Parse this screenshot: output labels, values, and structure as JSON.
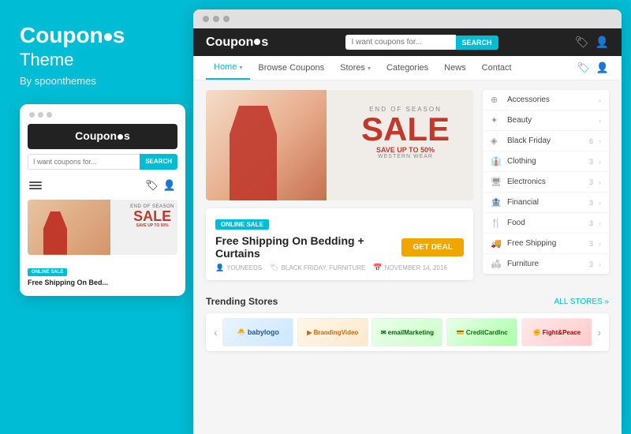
{
  "brand": {
    "name_part1": "Coupon",
    "name_dot": "●",
    "name_part2": "s",
    "subtitle": "Theme",
    "by": "By spoonthemes"
  },
  "mobile": {
    "logo": "Coupon●s",
    "search_placeholder": "I want coupons for...",
    "search_btn": "SEARCH",
    "sale_label": "END OF SEASON",
    "sale_text": "SALE",
    "sale_sub": "SAVE UP TO 50%",
    "coupon_badge": "ONLINE SALE",
    "coupon_title": "Free Shipping On Bed..."
  },
  "browser": {
    "site_logo": "Coupon●s",
    "search_placeholder": "I want coupons for...",
    "search_btn": "SEARCH",
    "nav_items": [
      {
        "label": "Home",
        "arrow": true,
        "active": true
      },
      {
        "label": "Browse Coupons",
        "arrow": false,
        "active": false
      },
      {
        "label": "Stores",
        "arrow": true,
        "active": false
      },
      {
        "label": "Categories",
        "arrow": false,
        "active": false
      },
      {
        "label": "News",
        "arrow": false,
        "active": false
      },
      {
        "label": "Contact",
        "arrow": false,
        "active": false
      }
    ],
    "hero": {
      "eos": "END OF SEASON",
      "sale": "SALE",
      "save": "SAVE UP TO 50%",
      "western": "WESTERN WEAR"
    },
    "coupon": {
      "badge": "ONLINE SALE",
      "title": "Free Shipping On Bedding + Curtains",
      "deal_btn": "GET DEAL",
      "meta": [
        {
          "icon": "👤",
          "text": "YOUNEEDS"
        },
        {
          "icon": "🏷",
          "text": "BLACK FRIDAY, FURNITURE"
        },
        {
          "icon": "📅",
          "text": "NOVEMBER 14, 2016"
        }
      ]
    },
    "categories": [
      {
        "icon": "⊕",
        "label": "Accessories",
        "count": ""
      },
      {
        "icon": "✦",
        "label": "Beauty",
        "count": ""
      },
      {
        "icon": "◈",
        "label": "Black Friday",
        "count": "6"
      },
      {
        "icon": "👔",
        "label": "Clothing",
        "count": "3"
      },
      {
        "icon": "🖥",
        "label": "Electronics",
        "count": "3"
      },
      {
        "icon": "🏦",
        "label": "Financial",
        "count": "3"
      },
      {
        "icon": "🍴",
        "label": "Food",
        "count": "3"
      },
      {
        "icon": "🚚",
        "label": "Free Shipping",
        "count": "3"
      },
      {
        "icon": "🛋",
        "label": "Furniture",
        "count": "3"
      }
    ],
    "trending": {
      "title": "Trending Stores",
      "all_label": "ALL STORES »"
    },
    "stores": [
      {
        "name": "Babylogo",
        "style": "babylogo"
      },
      {
        "name": "BrandingVideo",
        "style": "brandingvideo"
      },
      {
        "name": "emailMarketing",
        "style": "emailmarketing"
      },
      {
        "name": "CreditCardInc",
        "style": "creditcard"
      },
      {
        "name": "Fight&Peace",
        "style": "fightpeace"
      }
    ]
  }
}
